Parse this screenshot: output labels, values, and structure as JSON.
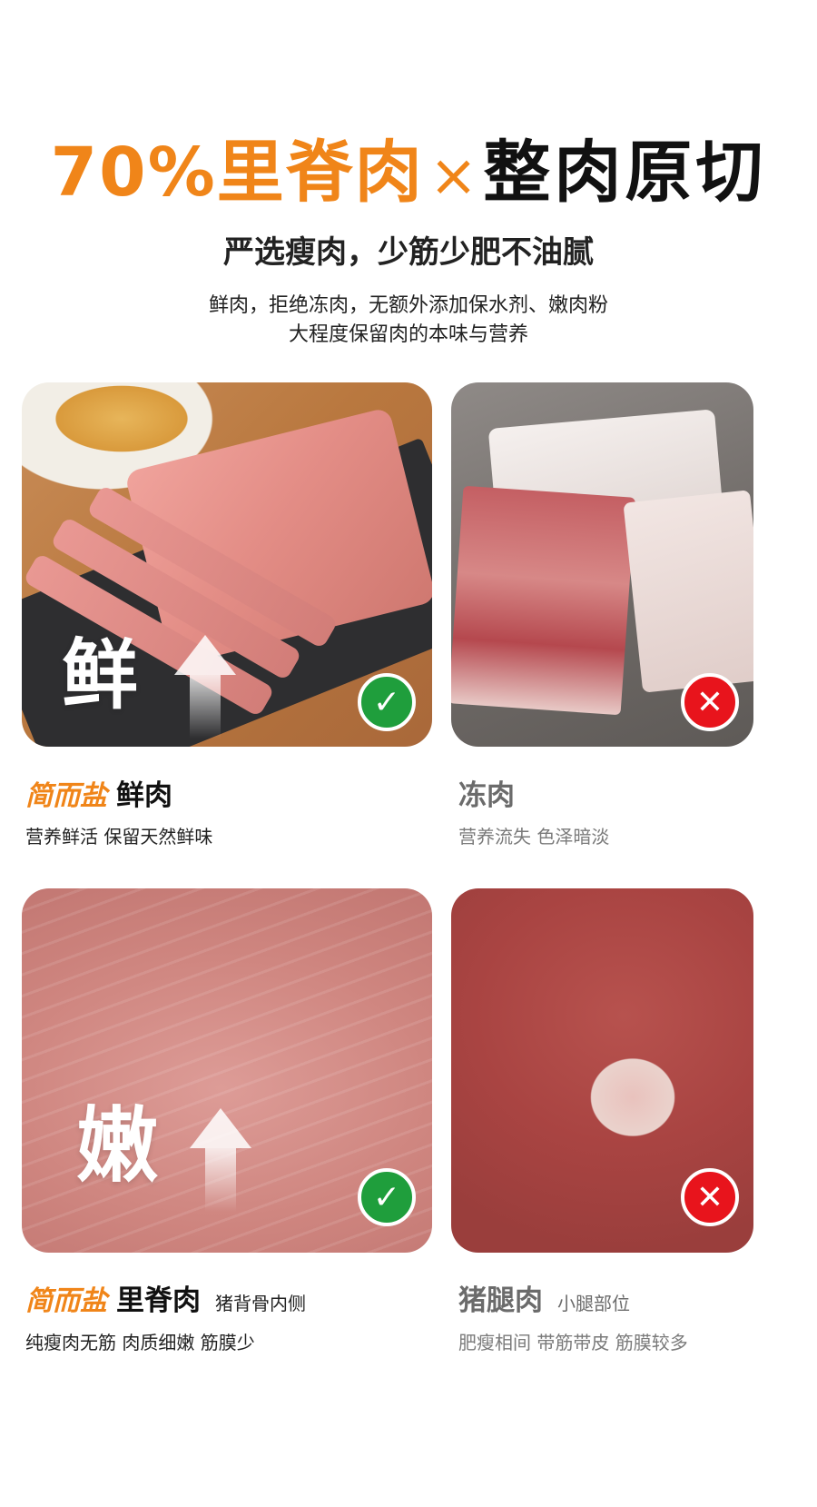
{
  "headline": {
    "highlight": "70%里脊肉",
    "separator": "×",
    "main": "整肉原切"
  },
  "subhead": "严选瘦肉，少筋少肥不油腻",
  "description": {
    "line1": "鲜肉，拒绝冻肉，无额外添加保水剂、嫩肉粉",
    "line2": "大程度保留肉的本味与营养"
  },
  "cards": [
    {
      "brand": "简而盐",
      "title": "鲜肉",
      "note": "",
      "caption": "营养鲜活  保留天然鲜味",
      "overlay_char": "鲜",
      "badge": "✓",
      "verdict": "good"
    },
    {
      "brand": "",
      "title": "冻肉",
      "note": "",
      "caption": "营养流失  色泽暗淡",
      "overlay_char": "",
      "badge": "✕",
      "verdict": "bad"
    },
    {
      "brand": "简而盐",
      "title": "里脊肉",
      "note": "猪背骨内侧",
      "caption": "纯瘦肉无筋  肉质细嫩  筋膜少",
      "overlay_char": "嫩",
      "badge": "✓",
      "verdict": "good"
    },
    {
      "brand": "",
      "title": "猪腿肉",
      "note": "小腿部位",
      "caption": "肥瘦相间  带筋带皮  筋膜较多",
      "overlay_char": "",
      "badge": "✕",
      "verdict": "bad"
    }
  ],
  "colors": {
    "accent": "#f08519",
    "good": "#1f9e3c",
    "bad": "#e8141c",
    "muted": "#6b6b6b"
  }
}
